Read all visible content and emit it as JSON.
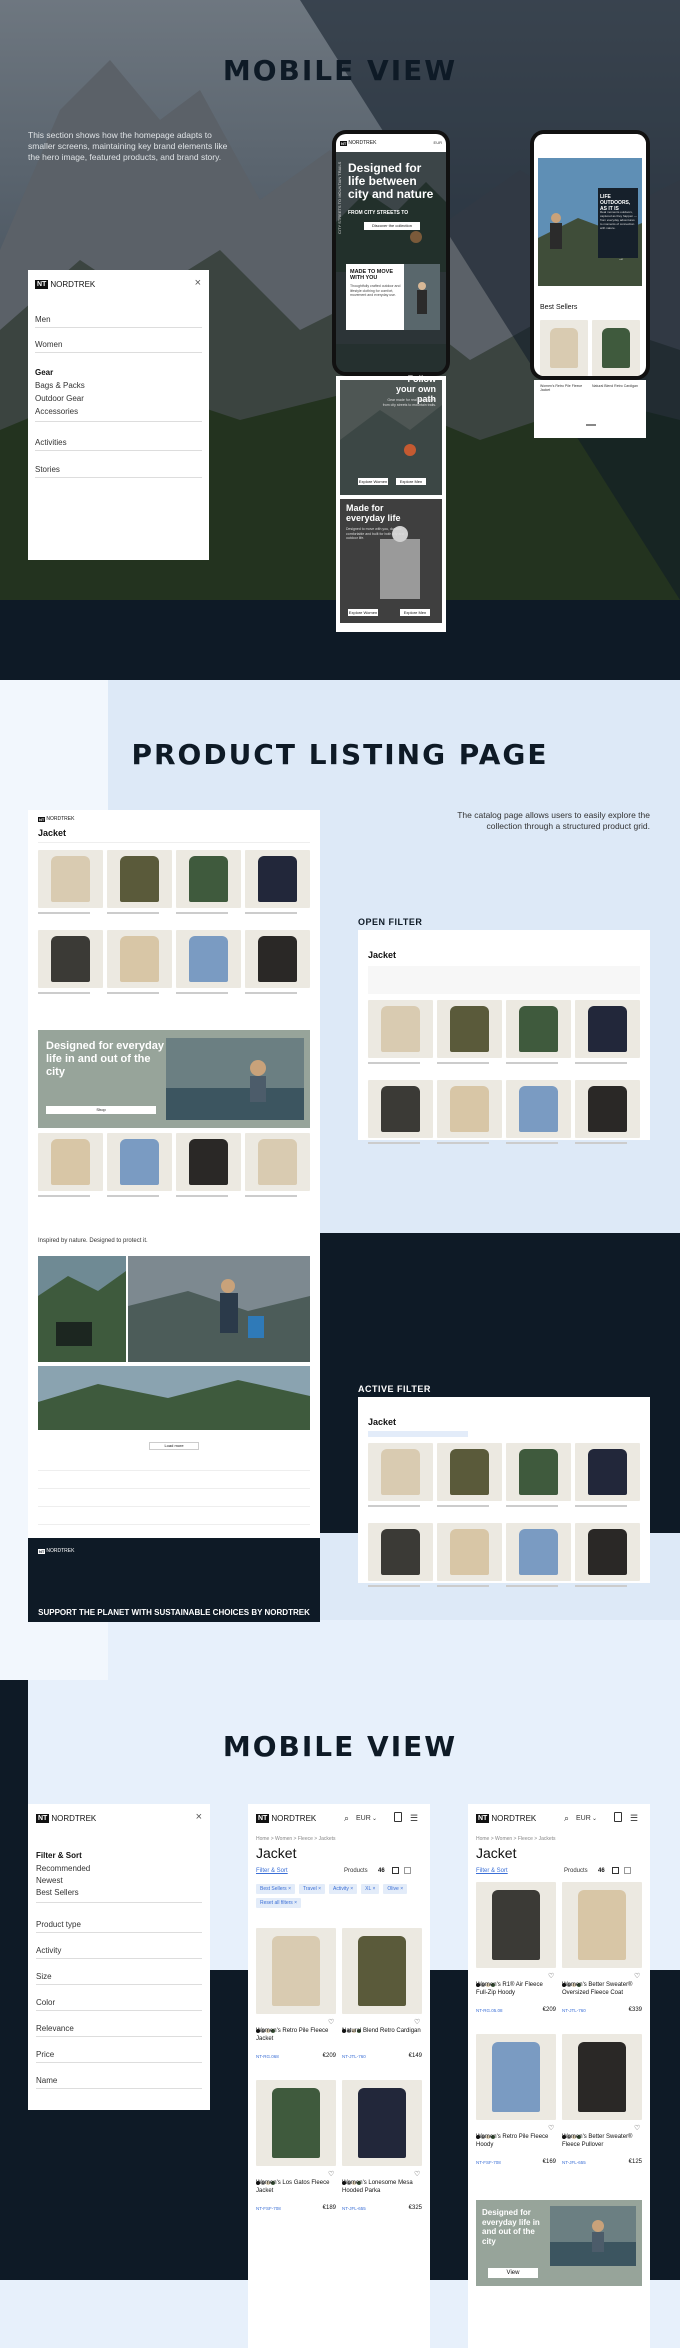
{
  "section1": {
    "title": "MOBILE VIEW",
    "description": "This section shows how the homepage adapts to smaller screens, maintaining key brand elements like the hero image, featured products, and brand story."
  },
  "brand": {
    "logo_mark": "NT",
    "name": "NORDTREK"
  },
  "menu": {
    "items": [
      "Men",
      "Women",
      "Gear",
      "Bags & Packs",
      "Outdoor Gear",
      "Accessories",
      "Activities",
      "Stories"
    ]
  },
  "phone1": {
    "header_currency": "EUR",
    "hero_title": "Designed for life between city and nature",
    "hero_sub": "FROM CITY STREETS TO",
    "hero_button": "Discover the collection",
    "side_text": "CITY STREETS TO MOUNTAIN TRAILS",
    "card_title": "MADE TO MOVE WITH YOU",
    "card_text": "Thoughtfully crafted outdoor and lifestyle clothing for comfort, movement and everyday use.",
    "follow_title": "Follow your own path",
    "follow_text": "Gear made for real adventures, from city streets to mountain trails.",
    "btn_explore_women": "Explore Women",
    "btn_explore_men": "Explore Men",
    "made_title": "Made for everyday life",
    "made_text": "Designed to move with you, durable, comfortable and built for both city and outdoor life.",
    "btn_explore_women2": "Explore Women",
    "btn_explore_men2": "Explore Men"
  },
  "phone2": {
    "hero_title": "LIFE OUTDOORS, AS IT IS",
    "hero_text": "Real moments outdoors, captured as they happen — from everyday adventures to moments of connection with nature.",
    "bestsellers": "Best Sellers",
    "p1_name": "Women's Retro Pile Fleece Jacket",
    "p2_name": "Natural Blend Retro Cardigan"
  },
  "section2": {
    "title": "PRODUCT LISTING PAGE",
    "description": "The catalog page allows users to easily explore the collection through a structured product grid.",
    "open_filter": "OPEN FILTER",
    "active_filter": "ACTIVE FILTER"
  },
  "plp": {
    "page_title": "Jacket",
    "banner_text": "Designed for everyday life in and out of the city",
    "banner_button": "Shop",
    "inspired": "Inspired by nature. Designed to protect it.",
    "load_more": "Load more",
    "footer_band": "SUPPORT THE PLANET WITH SUSTAINABLE CHOICES BY NORDTREK",
    "products_label": "Products"
  },
  "section3": {
    "title": "MOBILE VIEW"
  },
  "filter_panel": {
    "heading": "Filter & Sort",
    "sort_options": [
      "Recommended",
      "Newest",
      "Best Sellers"
    ],
    "groups": [
      "Product type",
      "Activity",
      "Size",
      "Color",
      "Relevance",
      "Price",
      "Name"
    ]
  },
  "mplp1": {
    "currency": "EUR",
    "breadcrumb": "Home > Women > Fleece > Jackets",
    "title": "Jacket",
    "filter_link": "Filter & Sort",
    "products_label": "Products",
    "products_count": "46",
    "chips": [
      "Best Sellers ×",
      "Travel ×",
      "Activity ×",
      "XL ×",
      "Olive ×",
      "Reset all filters ×"
    ],
    "products": [
      {
        "name": "Women's Retro Pile Fleece Jacket",
        "code": "NT-RG.068",
        "price": "€209"
      },
      {
        "name": "Natural Blend Retro Cardigan",
        "code": "NT-JTL-760",
        "price": "€149"
      },
      {
        "name": "Women's Los Gatos Fleece Jacket",
        "code": "NT-FSF-708",
        "price": "€189"
      },
      {
        "name": "Women's Lonesome Mesa Hooded Parka",
        "code": "NT-JFL-655",
        "price": "€325"
      }
    ]
  },
  "mplp2": {
    "currency": "EUR",
    "breadcrumb": "Home > Women > Fleece > Jackets",
    "title": "Jacket",
    "filter_link": "Filter & Sort",
    "products_label": "Products",
    "products_count": "46",
    "products": [
      {
        "name": "Women's R1® Air Fleece Full-Zip Hoody",
        "code": "NT-RG.05.08",
        "price": "€209"
      },
      {
        "name": "Women's Better Sweater® Oversized Fleece Coat",
        "code": "NT-JTL-760",
        "price": "€339"
      },
      {
        "name": "Women's Retro Pile Fleece Hoody",
        "code": "NT-FSF-708",
        "price": "€169"
      },
      {
        "name": "Women's Better Sweater® Fleece Pullover",
        "code": "NT-JFL-655",
        "price": "€125"
      }
    ],
    "banner_text": "Designed for everyday life in and out of the city",
    "banner_button": "View"
  },
  "colors": {
    "navy": "#0e1a26",
    "sage": "#97a49a",
    "accent": "#3b6fd6",
    "light": "#e7f0fb"
  }
}
